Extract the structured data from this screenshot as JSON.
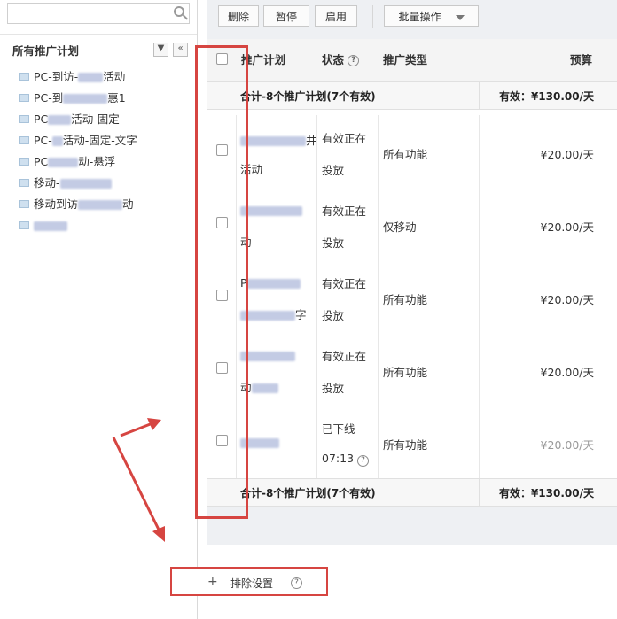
{
  "left": {
    "search_placeholder": "",
    "tree_title": "所有推广计划",
    "collapse_glyph": "«",
    "dropdown_glyph": "▼",
    "items": [
      {
        "pre": "PC-到访-",
        "post": "活动"
      },
      {
        "pre": "PC-到",
        "post": "惠1"
      },
      {
        "pre": "PC",
        "post": "活动-固定"
      },
      {
        "pre": "PC-",
        "post": "活动-固定-文字"
      },
      {
        "pre": "PC",
        "post": "动-悬浮"
      },
      {
        "pre": "移动-",
        "post": ""
      },
      {
        "pre": "移动到访",
        "post": "动"
      },
      {
        "pre": "",
        "post": ""
      }
    ],
    "exclude": {
      "plus": "+",
      "label": "排除设置",
      "help": "?"
    }
  },
  "toolbar": {
    "delete": "删除",
    "pause": "暂停",
    "enable": "启用",
    "batch": "批量操作"
  },
  "table": {
    "headers": {
      "plan": "推广计划",
      "status": "状态",
      "status_help": "?",
      "type": "推广类型",
      "budget": "预算"
    },
    "summary_left": "合计-8个推广计划(7个有效)",
    "summary_right": "有效：¥130.00/天",
    "rows": [
      {
        "name_tail": "井",
        "name_line2": "活动",
        "status": "有效",
        "status2": "正在",
        "status3": "投放",
        "type": "所有功能",
        "budget": "¥20.00/天"
      },
      {
        "name_tail": "",
        "name_line2": "动",
        "status": "有效",
        "status2": "正在",
        "status3": "投放",
        "type": "仅移动",
        "budget": "¥20.00/天"
      },
      {
        "name_tail": "",
        "name_line1_head": "P",
        "name_line2": "字",
        "status": "有效",
        "status2": "正在",
        "status3": "投放",
        "type": "所有功能",
        "budget": "¥20.00/天"
      },
      {
        "name_tail": "",
        "name_line2": "动",
        "status": "有效",
        "status2": "正在",
        "status3": "投放",
        "type": "所有功能",
        "budget": "¥20.00/天"
      },
      {
        "name_tail": "",
        "name_line2": "",
        "status": "已下线",
        "status2": "07:13",
        "status3": "",
        "type": "所有功能",
        "budget": "¥20.00/天"
      }
    ]
  },
  "colors": {
    "accent_red": "#d64541",
    "ok_green": "#2e9e2e",
    "offline_yellow": "#e7b400"
  }
}
